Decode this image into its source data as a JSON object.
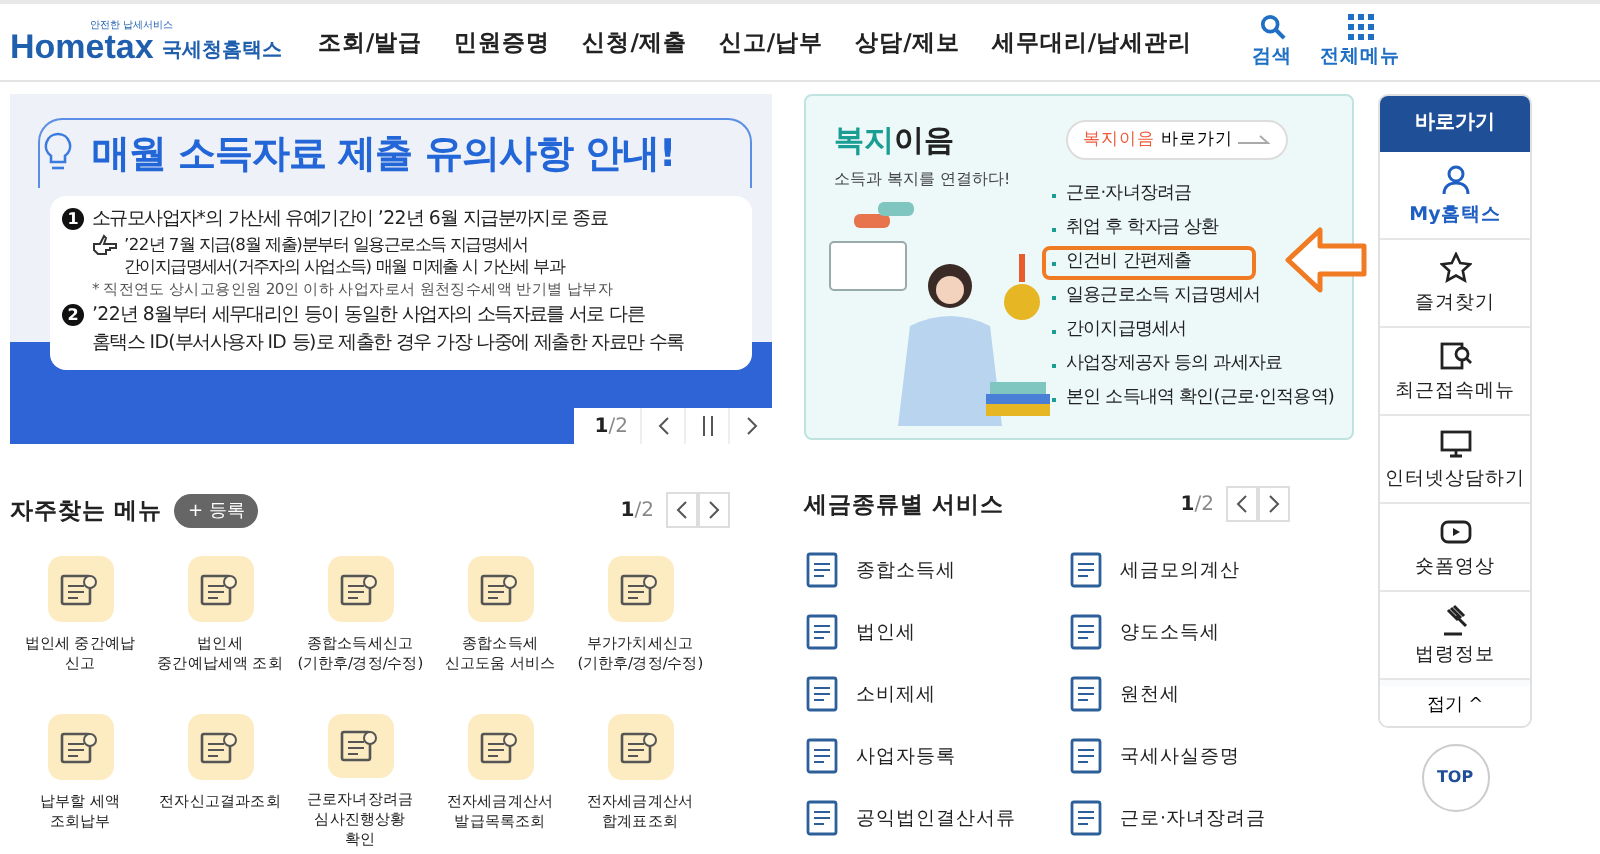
{
  "header": {
    "logo": {
      "tagline": "안전한 납세서비스",
      "wordmark": "Hometax",
      "name": "국세청홈택스"
    },
    "nav": [
      "조회/발급",
      "민원증명",
      "신청/제출",
      "신고/납부",
      "상담/제보",
      "세무대리/납세관리"
    ],
    "tools": [
      {
        "kind": "search",
        "label": "검색"
      },
      {
        "kind": "grid",
        "label": "전체메뉴"
      }
    ]
  },
  "banner": {
    "title": "매월 소득자료 제출 유의사항 안내!",
    "items": [
      {
        "marker": "1",
        "text": "소규모사업자*의 가산세 유예기간이 ’22년 6월 지급분까지로 종료",
        "sub": "’22년 7월 지급(8월 제출)분부터 일용근로소득 지급명세서\n간이지급명세서(거주자의 사업소득) 매월 미제출 시 가산세 부과",
        "note": "* 직전연도 상시고용인원 20인 이하 사업자로서 원천징수세액 반기별 납부자"
      },
      {
        "marker": "2",
        "text": "’22년 8월부터 세무대리인 등이 동일한 사업자의 소득자료를 서로 다른\n홈택스 ID(부서사용자 ID 등)로 제출한 경우 가장 나중에 제출한 자료만 수록"
      }
    ],
    "pager": {
      "current": "1",
      "total": "/2"
    }
  },
  "welfare": {
    "title_accent": "복지",
    "title_rest": "이음",
    "subtitle": "소득과 복지를 연결하다!",
    "button_accent": "복지이음",
    "button_rest": "바로가기",
    "items": [
      {
        "label": "근로·자녀장려금",
        "highlighted": false
      },
      {
        "label": "취업 후 학자금 상환",
        "highlighted": false
      },
      {
        "label": "인건비 간편제출",
        "highlighted": true
      },
      {
        "label": "일용근로소득 지급명세서",
        "highlighted": false
      },
      {
        "label": "간이지급명세서",
        "highlighted": false
      },
      {
        "label": "사업장제공자 등의 과세자료",
        "highlighted": false
      },
      {
        "label": "본인 소득내역 확인(근로·인적용역)",
        "highlighted": false
      }
    ]
  },
  "quick": {
    "title": "바로가기",
    "items": [
      {
        "kind": "person",
        "label": "My홈택스",
        "selected": true
      },
      {
        "kind": "star",
        "label": "즐겨찾기",
        "selected": false
      },
      {
        "kind": "recent",
        "label": "최근접속메뉴",
        "selected": false
      },
      {
        "kind": "monitor",
        "label": "인터넷상담하기",
        "selected": false
      },
      {
        "kind": "play",
        "label": "숏폼영상",
        "selected": false
      },
      {
        "kind": "gavel",
        "label": "법령정보",
        "selected": false
      }
    ],
    "collapse": "접기 ^",
    "top": "TOP"
  },
  "frequent": {
    "title": "자주찾는 메뉴",
    "add": "+ 등록",
    "page": "1",
    "total": "/2",
    "items": [
      "법인세 중간예납\n신고",
      "법인세\n중간예납세액 조회",
      "종합소득세신고\n(기한후/경정/수정)",
      "종합소득세\n신고도움 서비스",
      "부가가치세신고\n(기한후/경정/수정)",
      "납부할 세액\n조회납부",
      "전자신고결과조회",
      "근로자녀장려금\n심사진행상황\n확인",
      "전자세금계산서\n발급목록조회",
      "전자세금계산서\n합계표조회"
    ]
  },
  "tax_services": {
    "title": "세금종류별 서비스",
    "page": "1",
    "total": "/2",
    "items": [
      "종합소득세",
      "세금모의계산",
      "법인세",
      "양도소득세",
      "소비제세",
      "원천세",
      "사업자등록",
      "국세사실증명",
      "공익법인결산서류",
      "근로·자녀장려금"
    ]
  }
}
